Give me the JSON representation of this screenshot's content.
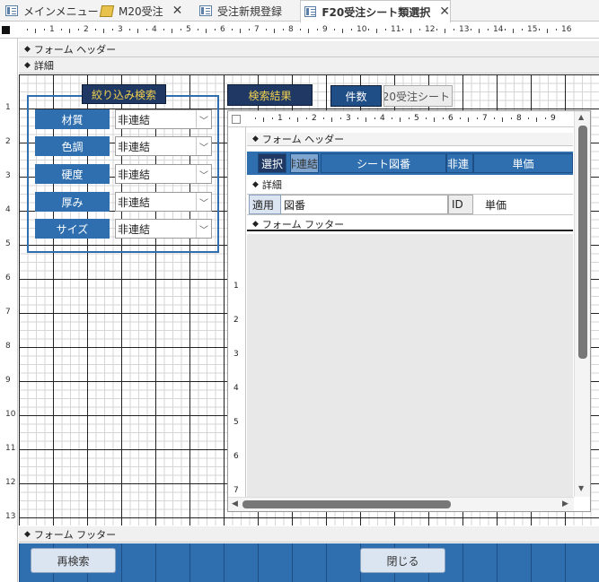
{
  "tabs": [
    {
      "label": "メインメニュー",
      "icon": "form-icon"
    },
    {
      "label": "M20受注",
      "icon": "query-icon"
    },
    {
      "label": "受注新規登録",
      "icon": "form-icon"
    },
    {
      "label": "F20受注シート類選択",
      "icon": "form-icon",
      "active": true
    }
  ],
  "ruler": {
    "h_ticks": [
      "1",
      "2",
      "3",
      "4",
      "5",
      "6",
      "7",
      "8",
      "9",
      "10",
      "11",
      "12",
      "13",
      "14",
      "15",
      "16"
    ],
    "v_ticks": [
      "1",
      "2",
      "3",
      "4",
      "5",
      "6",
      "7",
      "8",
      "9",
      "10",
      "11",
      "12",
      "13"
    ]
  },
  "sections": {
    "form_header": "フォーム ヘッダー",
    "detail": "詳細",
    "form_footer": "フォーム フッター"
  },
  "filter": {
    "title": "絞り込み検索",
    "rows": [
      {
        "label": "材質",
        "value": "非連結"
      },
      {
        "label": "色調",
        "value": "非連結"
      },
      {
        "label": "硬度",
        "value": "非連結"
      },
      {
        "label": "厚み",
        "value": "非連結"
      },
      {
        "label": "サイズ",
        "value": "非連結"
      }
    ]
  },
  "results": {
    "title": "検索結果",
    "count_label": "件数",
    "subform_name": "F20受注シート"
  },
  "subform": {
    "ticks": [
      "1",
      "2",
      "3",
      "4",
      "5",
      "6",
      "7",
      "8",
      "9"
    ],
    "vticks": [
      "1",
      "2",
      "3",
      "4",
      "5",
      "6",
      "7"
    ],
    "header_band": "フォーム ヘッダー",
    "detail_band": "詳細",
    "footer_band": "フォーム フッター",
    "header_cells": [
      "選択",
      "非連結",
      "シート図番",
      "非連",
      "単価"
    ],
    "detail_cells": [
      "適用",
      "図番",
      "ID",
      "単価"
    ]
  },
  "footer": {
    "research_button": "再検索",
    "close_button": "閉じる"
  },
  "colors": {
    "accent": "#2f6fb0",
    "dark": "#1f3864",
    "gold": "#f0d050"
  }
}
